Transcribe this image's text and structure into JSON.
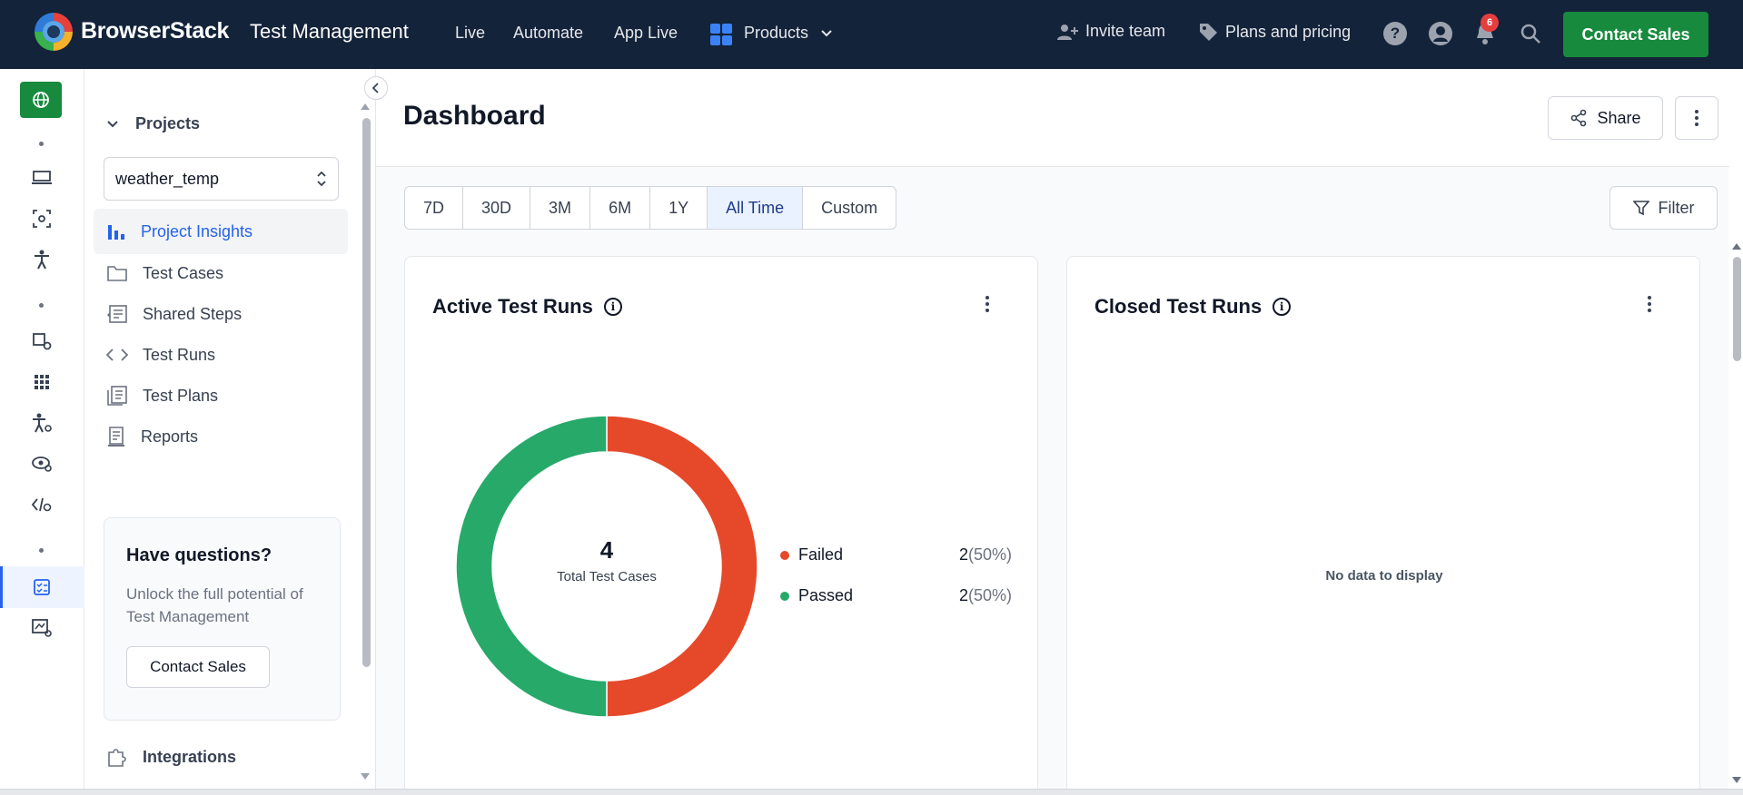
{
  "topbar": {
    "brand": "BrowserStack",
    "product": "Test Management",
    "nav": [
      "Live",
      "Automate",
      "App Live"
    ],
    "products_label": "Products",
    "invite_label": "Invite team",
    "plans_label": "Plans and pricing",
    "notification_count": "6",
    "contact_label": "Contact Sales"
  },
  "sidebar": {
    "projects_label": "Projects",
    "selected_project": "weather_temp",
    "items": [
      {
        "label": "Project Insights",
        "icon": "bar-chart-icon"
      },
      {
        "label": "Test Cases",
        "icon": "folder-icon"
      },
      {
        "label": "Shared Steps",
        "icon": "shared-steps-icon"
      },
      {
        "label": "Test Runs",
        "icon": "code-icon"
      },
      {
        "label": "Test Plans",
        "icon": "test-plans-icon"
      },
      {
        "label": "Reports",
        "icon": "reports-icon"
      }
    ],
    "help": {
      "title": "Have questions?",
      "text": "Unlock the full potential of Test Management",
      "button": "Contact Sales"
    },
    "integrations_label": "Integrations"
  },
  "main": {
    "title": "Dashboard",
    "share_label": "Share",
    "filter_label": "Filter",
    "ranges": [
      "7D",
      "30D",
      "3M",
      "6M",
      "1Y",
      "All Time",
      "Custom"
    ],
    "selected_range": "All Time"
  },
  "active_runs": {
    "title": "Active Test Runs",
    "total": "4",
    "total_label": "Total Test Cases"
  },
  "closed_runs": {
    "title": "Closed Test Runs",
    "empty_text": "No data to display"
  },
  "chart_data": {
    "type": "pie",
    "categories": [
      "Failed",
      "Passed"
    ],
    "values": [
      2,
      2
    ],
    "percent_labels": [
      "(50%)",
      "(50%)"
    ],
    "colors": [
      "#e5492a",
      "#27a96a"
    ],
    "center_value": "4",
    "center_label": "Total Test Cases"
  },
  "colors": {
    "topbar": "#13233a",
    "accent_green": "#178a3e",
    "active_blue": "#2563eb"
  }
}
